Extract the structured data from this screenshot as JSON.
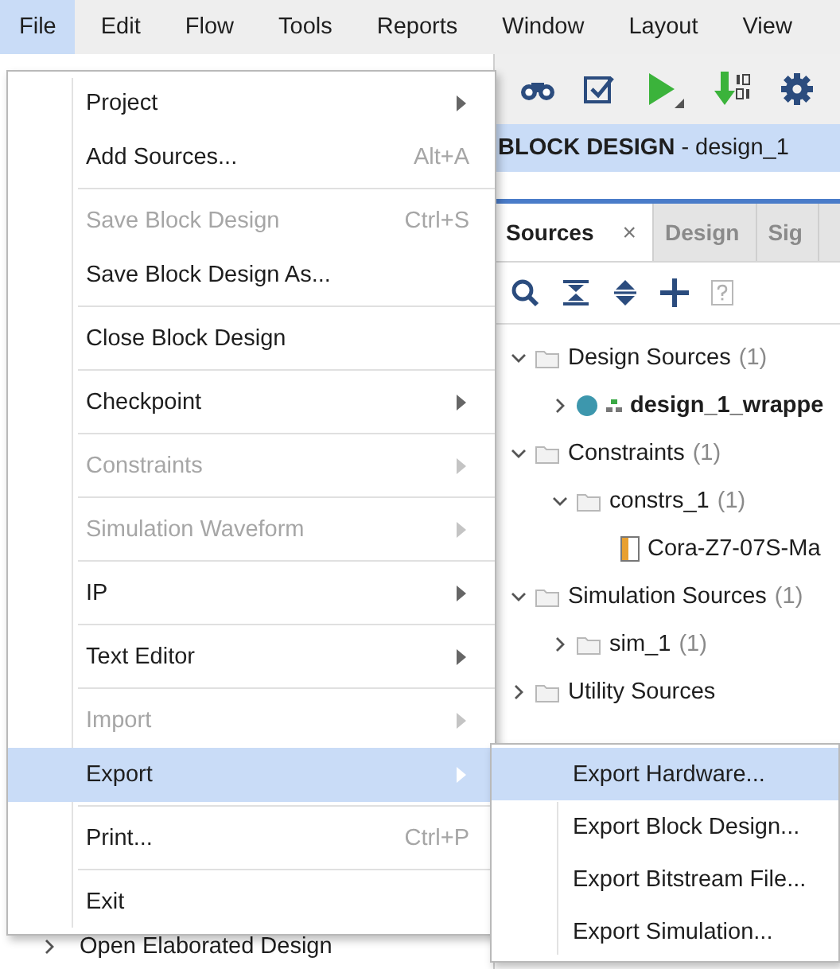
{
  "menu_bar": [
    {
      "label": "File",
      "selected": true
    },
    {
      "label": "Edit",
      "selected": false
    },
    {
      "label": "Flow",
      "selected": false
    },
    {
      "label": "Tools",
      "selected": false
    },
    {
      "label": "Reports",
      "selected": false
    },
    {
      "label": "Window",
      "selected": false
    },
    {
      "label": "Layout",
      "selected": false
    },
    {
      "label": "View",
      "selected": false
    }
  ],
  "file_menu": {
    "groups": [
      [
        {
          "label": "Project",
          "submenu": true,
          "disabled": false,
          "selected": false
        },
        {
          "label": "Add Sources...",
          "shortcut": "Alt+A",
          "submenu": false,
          "disabled": false,
          "selected": false
        }
      ],
      [
        {
          "label": "Save Block Design",
          "shortcut": "Ctrl+S",
          "submenu": false,
          "disabled": true,
          "selected": false
        },
        {
          "label": "Save Block Design As...",
          "submenu": false,
          "disabled": false,
          "selected": false
        }
      ],
      [
        {
          "label": "Close Block Design",
          "submenu": false,
          "disabled": false,
          "selected": false
        }
      ],
      [
        {
          "label": "Checkpoint",
          "submenu": true,
          "disabled": false,
          "selected": false
        }
      ],
      [
        {
          "label": "Constraints",
          "submenu": true,
          "disabled": true,
          "selected": false
        }
      ],
      [
        {
          "label": "Simulation Waveform",
          "submenu": true,
          "disabled": true,
          "selected": false
        }
      ],
      [
        {
          "label": "IP",
          "submenu": true,
          "disabled": false,
          "selected": false
        }
      ],
      [
        {
          "label": "Text Editor",
          "submenu": true,
          "disabled": false,
          "selected": false
        }
      ],
      [
        {
          "label": "Import",
          "submenu": true,
          "disabled": true,
          "selected": false
        },
        {
          "label": "Export",
          "submenu": true,
          "disabled": false,
          "selected": true
        }
      ],
      [
        {
          "label": "Print...",
          "shortcut": "Ctrl+P",
          "submenu": false,
          "disabled": false,
          "selected": false
        }
      ],
      [
        {
          "label": "Exit",
          "submenu": false,
          "disabled": false,
          "selected": false
        }
      ]
    ]
  },
  "export_submenu": [
    {
      "label": "Export Hardware...",
      "selected": true
    },
    {
      "label": "Export Block Design...",
      "selected": false
    },
    {
      "label": "Export Bitstream File...",
      "selected": false
    },
    {
      "label": "Export Simulation...",
      "selected": false
    }
  ],
  "design_header": "**BLOCK DESIGN** - design_1",
  "tabs": [
    {
      "label": "Sources",
      "selected": true,
      "close": "×"
    },
    {
      "label": "Design",
      "selected": false
    },
    {
      "label": "Sig",
      "selected": false
    }
  ],
  "source_tree": [
    {
      "kind": "folder",
      "name": "Design Sources",
      "count": "(1)",
      "expanded": true,
      "children": [
        {
          "kind": "block",
          "name": "design_1_wrappe",
          "expanded": false
        }
      ]
    },
    {
      "kind": "folder",
      "name": "Constraints",
      "count": "(1)",
      "expanded": true,
      "children": [
        {
          "kind": "folder",
          "name": "constrs_1",
          "count": "(1)",
          "expanded": true,
          "children": [
            {
              "kind": "file",
              "name": "Cora-Z7-07S-Ma"
            }
          ]
        }
      ]
    },
    {
      "kind": "folder",
      "name": "Simulation Sources",
      "count": "(1)",
      "expanded": true,
      "children": [
        {
          "kind": "folder",
          "name": "sim_1",
          "count": "(1)",
          "expanded": false
        }
      ]
    },
    {
      "kind": "folder",
      "name": "Utility Sources",
      "expanded": false
    }
  ],
  "flow_navigator": {
    "label": "Open Elaborated Design",
    "expanded": false
  }
}
